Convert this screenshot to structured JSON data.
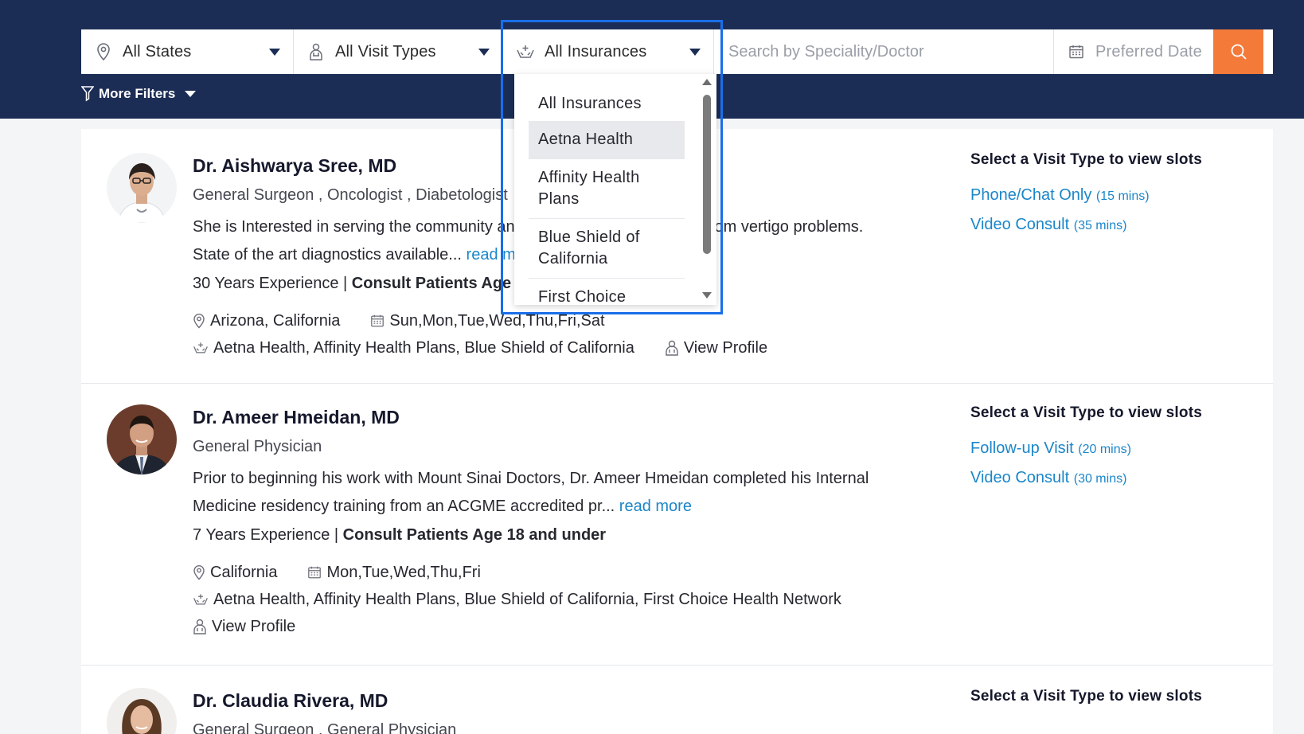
{
  "filters": {
    "states_label": "All States",
    "visit_types_label": "All Visit Types",
    "insurances_label": "All Insurances",
    "search_placeholder": "Search by Speciality/Doctor",
    "date_label": "Preferred Date",
    "more_filters_label": "More Filters"
  },
  "insurance_dropdown": {
    "items": [
      {
        "label": "All Insurances"
      },
      {
        "label": "Aetna Health"
      },
      {
        "label": "Affinity Health Plans"
      },
      {
        "label": "Blue Shield of California"
      },
      {
        "label": "First Choice"
      }
    ],
    "highlighted": "Aetna Health"
  },
  "slots_title": "Select a Visit Type to view slots",
  "view_profile_label": "View Profile",
  "read_more_label": "read more",
  "doctors": [
    {
      "name": "Dr. Aishwarya Sree, MD",
      "specialties": "General Surgeon , Oncologist , Diabetologist",
      "bio": "She is Interested in serving the community and helping those who suffer from vertigo problems. State of the art diagnostics available...",
      "experience": "30 Years Experience",
      "consult": "Consult Patients Age 18 and above",
      "states": "Arizona, California",
      "days": "Sun,Mon,Tue,Wed,Thu,Fri,Sat",
      "insurances": "Aetna Health, Affinity Health Plans, Blue Shield of California",
      "slots": [
        {
          "label": "Phone/Chat Only",
          "duration": "(15 mins)"
        },
        {
          "label": "Video Consult",
          "duration": "(35 mins)"
        }
      ]
    },
    {
      "name": "Dr. Ameer Hmeidan, MD",
      "specialties": "General Physician",
      "bio": "Prior to beginning his work with Mount Sinai Doctors, Dr. Ameer Hmeidan completed his Internal Medicine residency training from an ACGME accredited pr...",
      "experience": "7 Years Experience",
      "consult": "Consult Patients Age 18 and under",
      "states": "California",
      "days": "Mon,Tue,Wed,Thu,Fri",
      "insurances": "Aetna Health, Affinity Health Plans, Blue Shield of California, First Choice Health Network",
      "slots": [
        {
          "label": "Follow-up Visit",
          "duration": "(20 mins)"
        },
        {
          "label": "Video Consult",
          "duration": "(30 mins)"
        }
      ]
    },
    {
      "name": "Dr. Claudia Rivera, MD",
      "specialties": "General Surgeon , General Physician"
    }
  ],
  "colors": {
    "header_bg": "#1c2d55",
    "accent_orange": "#f47a3a",
    "link_blue": "#1b86c9",
    "focus_outline": "#1a6ee8"
  }
}
